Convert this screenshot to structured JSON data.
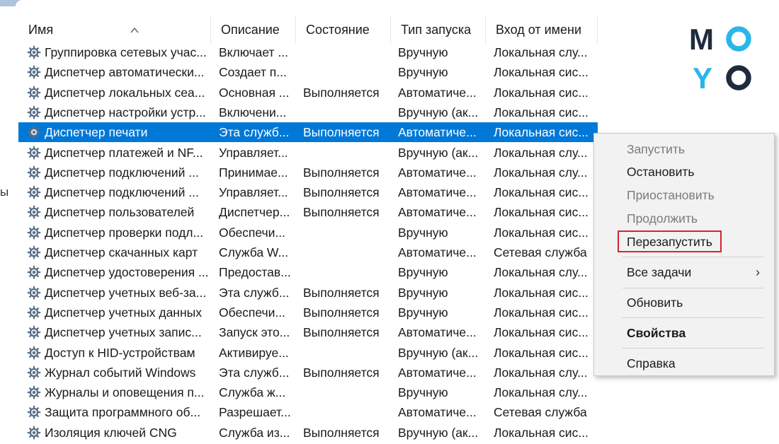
{
  "columns": {
    "name": "Имя",
    "description": "Описание",
    "status": "Состояние",
    "startup_type": "Тип запуска",
    "logon_as": "Вход от имени"
  },
  "left_edge_text": "ы",
  "services": [
    {
      "name": "Группировка сетевых учас...",
      "description": "Включает ...",
      "status": "",
      "startup_type": "Вручную",
      "logon_as": "Локальная слу..."
    },
    {
      "name": "Диспетчер автоматически...",
      "description": "Создает п...",
      "status": "",
      "startup_type": "Вручную",
      "logon_as": "Локальная сис..."
    },
    {
      "name": "Диспетчер локальных сеа...",
      "description": "Основная ...",
      "status": "Выполняется",
      "startup_type": "Автоматиче...",
      "logon_as": "Локальная сис..."
    },
    {
      "name": "Диспетчер настройки устр...",
      "description": "Включени...",
      "status": "",
      "startup_type": "Вручную (ак...",
      "logon_as": "Локальная сис..."
    },
    {
      "name": "Диспетчер печати",
      "description": "Эта служб...",
      "status": "Выполняется",
      "startup_type": "Автоматиче...",
      "logon_as": "Локальная сис...",
      "selected": true
    },
    {
      "name": "Диспетчер платежей и NF...",
      "description": "Управляет...",
      "status": "",
      "startup_type": "Вручную (ак...",
      "logon_as": "Локальная слу..."
    },
    {
      "name": "Диспетчер подключений ...",
      "description": "Принимае...",
      "status": "Выполняется",
      "startup_type": "Автоматиче...",
      "logon_as": "Локальная слу..."
    },
    {
      "name": "Диспетчер подключений ...",
      "description": "Управляет...",
      "status": "Выполняется",
      "startup_type": "Автоматиче...",
      "logon_as": "Локальная сис..."
    },
    {
      "name": "Диспетчер пользователей",
      "description": "Диспетчер...",
      "status": "Выполняется",
      "startup_type": "Автоматиче...",
      "logon_as": "Локальная сис..."
    },
    {
      "name": "Диспетчер проверки подл...",
      "description": "Обеспечи...",
      "status": "",
      "startup_type": "Вручную",
      "logon_as": "Локальная сис..."
    },
    {
      "name": "Диспетчер скачанных карт",
      "description": "Служба W...",
      "status": "",
      "startup_type": "Автоматиче...",
      "logon_as": "Сетевая служба"
    },
    {
      "name": "Диспетчер удостоверения ...",
      "description": "Предостав...",
      "status": "",
      "startup_type": "Вручную",
      "logon_as": "Локальная слу..."
    },
    {
      "name": "Диспетчер учетных веб-за...",
      "description": "Эта служб...",
      "status": "Выполняется",
      "startup_type": "Вручную",
      "logon_as": "Локальная сис..."
    },
    {
      "name": "Диспетчер учетных данных",
      "description": "Обеспечи...",
      "status": "Выполняется",
      "startup_type": "Вручную",
      "logon_as": "Локальная сис..."
    },
    {
      "name": "Диспетчер учетных запис...",
      "description": "Запуск это...",
      "status": "Выполняется",
      "startup_type": "Автоматиче...",
      "logon_as": "Локальная сис..."
    },
    {
      "name": "Доступ к HID-устройствам",
      "description": "Активируе...",
      "status": "",
      "startup_type": "Вручную (ак...",
      "logon_as": "Локальная сис..."
    },
    {
      "name": "Журнал событий Windows",
      "description": "Эта служб...",
      "status": "Выполняется",
      "startup_type": "Автоматиче...",
      "logon_as": "Локальная слу..."
    },
    {
      "name": "Журналы и оповещения п...",
      "description": "Служба ж...",
      "status": "",
      "startup_type": "Вручную",
      "logon_as": "Локальная слу..."
    },
    {
      "name": "Защита программного об...",
      "description": "Разрешает...",
      "status": "",
      "startup_type": "Автоматиче...",
      "logon_as": "Сетевая служба"
    },
    {
      "name": "Изоляция ключей CNG",
      "description": "Служба из...",
      "status": "Выполняется",
      "startup_type": "Вручную (ак...",
      "logon_as": "Локальная сис..."
    }
  ],
  "context_menu": {
    "start": "Запустить",
    "stop": "Остановить",
    "pause": "Приостановить",
    "resume": "Продолжить",
    "restart": "Перезапустить",
    "all_tasks": "Все задачи",
    "refresh": "Обновить",
    "properties": "Свойства",
    "help": "Справка",
    "submenu_glyph": "›"
  },
  "logo": {
    "letters": [
      "M",
      "O",
      "Y",
      "O"
    ],
    "colors": {
      "dark": "#1f2b3d",
      "accent": "#29b6e8"
    }
  },
  "colors": {
    "selection": "#0078d7",
    "highlight_box": "#d9232e"
  }
}
